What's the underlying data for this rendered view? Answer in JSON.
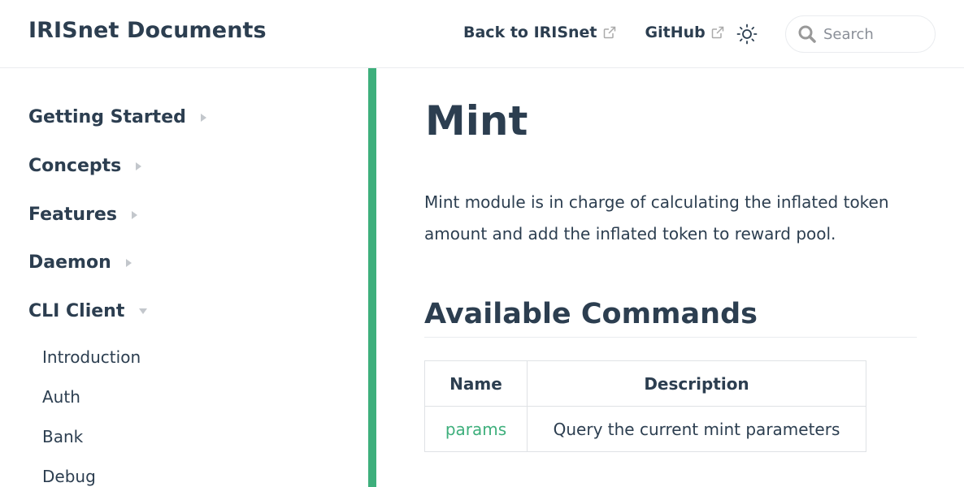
{
  "navbar": {
    "site_name": "IRISnet Documents",
    "links": [
      {
        "label": "Back to IRISnet"
      },
      {
        "label": "GitHub"
      }
    ],
    "search_placeholder": "Search"
  },
  "sidebar": {
    "groups": [
      {
        "label": "Getting Started",
        "state": "collapsed"
      },
      {
        "label": "Concepts",
        "state": "collapsed"
      },
      {
        "label": "Features",
        "state": "collapsed"
      },
      {
        "label": "Daemon",
        "state": "collapsed"
      },
      {
        "label": "CLI Client",
        "state": "expanded"
      }
    ],
    "cli_items": [
      "Introduction",
      "Auth",
      "Bank",
      "Debug"
    ]
  },
  "content": {
    "title": "Mint",
    "intro": "Mint module is in charge of calculating the inflated token amount and add the inflated token to reward pool.",
    "section_title": "Available Commands",
    "table": {
      "headers": [
        "Name",
        "Description"
      ],
      "rows": [
        {
          "name": "params",
          "description": "Query the current mint parameters"
        }
      ]
    }
  },
  "colors": {
    "accent": "#3eaf7c",
    "text": "#2c3e50",
    "border": "#eaecef"
  },
  "icons": [
    "external-link-icon",
    "sun-icon",
    "search-icon",
    "arrow-right-icon",
    "arrow-down-icon"
  ]
}
